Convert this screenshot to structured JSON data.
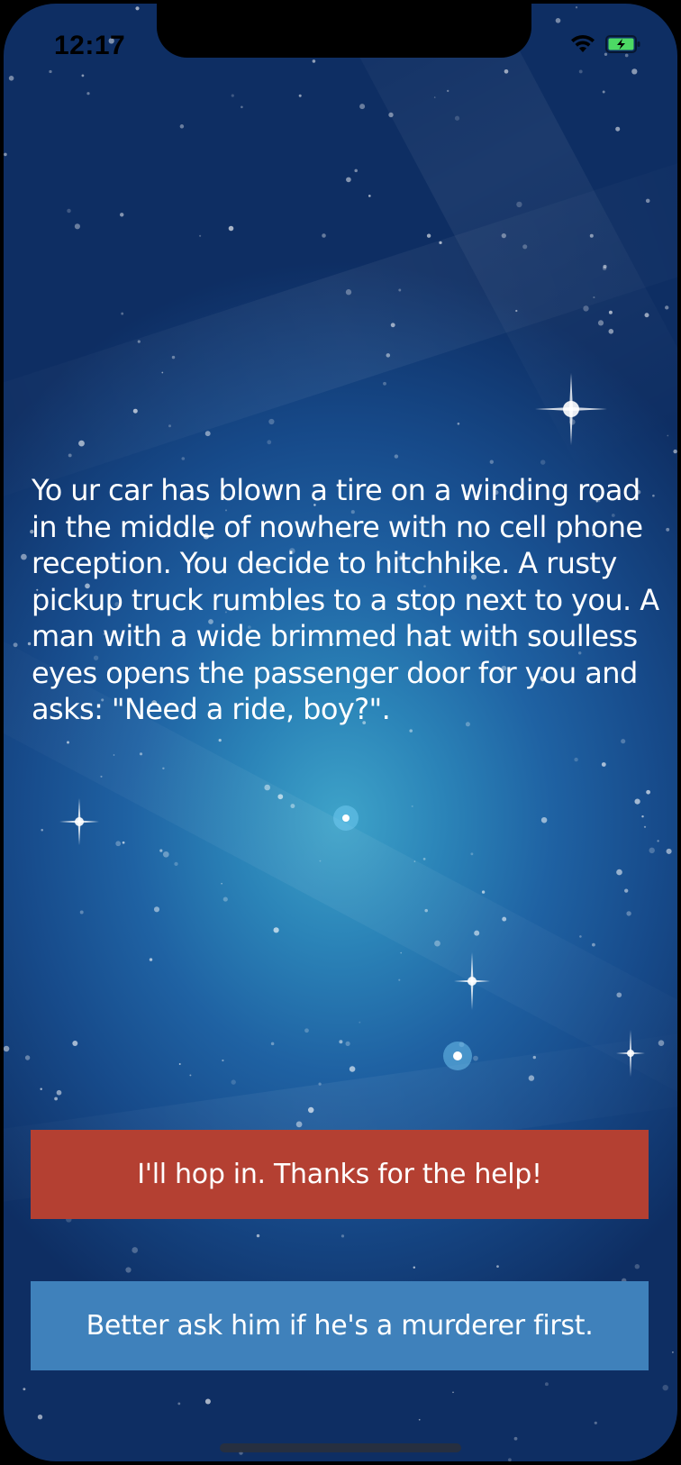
{
  "status_bar": {
    "time": "12:17",
    "icons": [
      "wifi-icon",
      "battery-charging-icon"
    ],
    "battery_color": "#4cd964"
  },
  "story": {
    "text": "Yo ur car has blown a tire on a winding road in the middle of nowhere with no cell phone reception. You decide to hitchhike. A rusty pickup truck rumbles to a stop next to you. A man with a wide brimmed hat with soulless eyes opens the passenger door for you and asks: \"Need a ride, boy?\"."
  },
  "choices": [
    {
      "label": "I'll hop in. Thanks for the help!",
      "color": "#b44032"
    },
    {
      "label": "Better ask him if he's a murderer first.",
      "color": "#3f81bb"
    }
  ],
  "colors": {
    "background_center": "#3ea3c9",
    "background_edge": "#0e2e63"
  }
}
